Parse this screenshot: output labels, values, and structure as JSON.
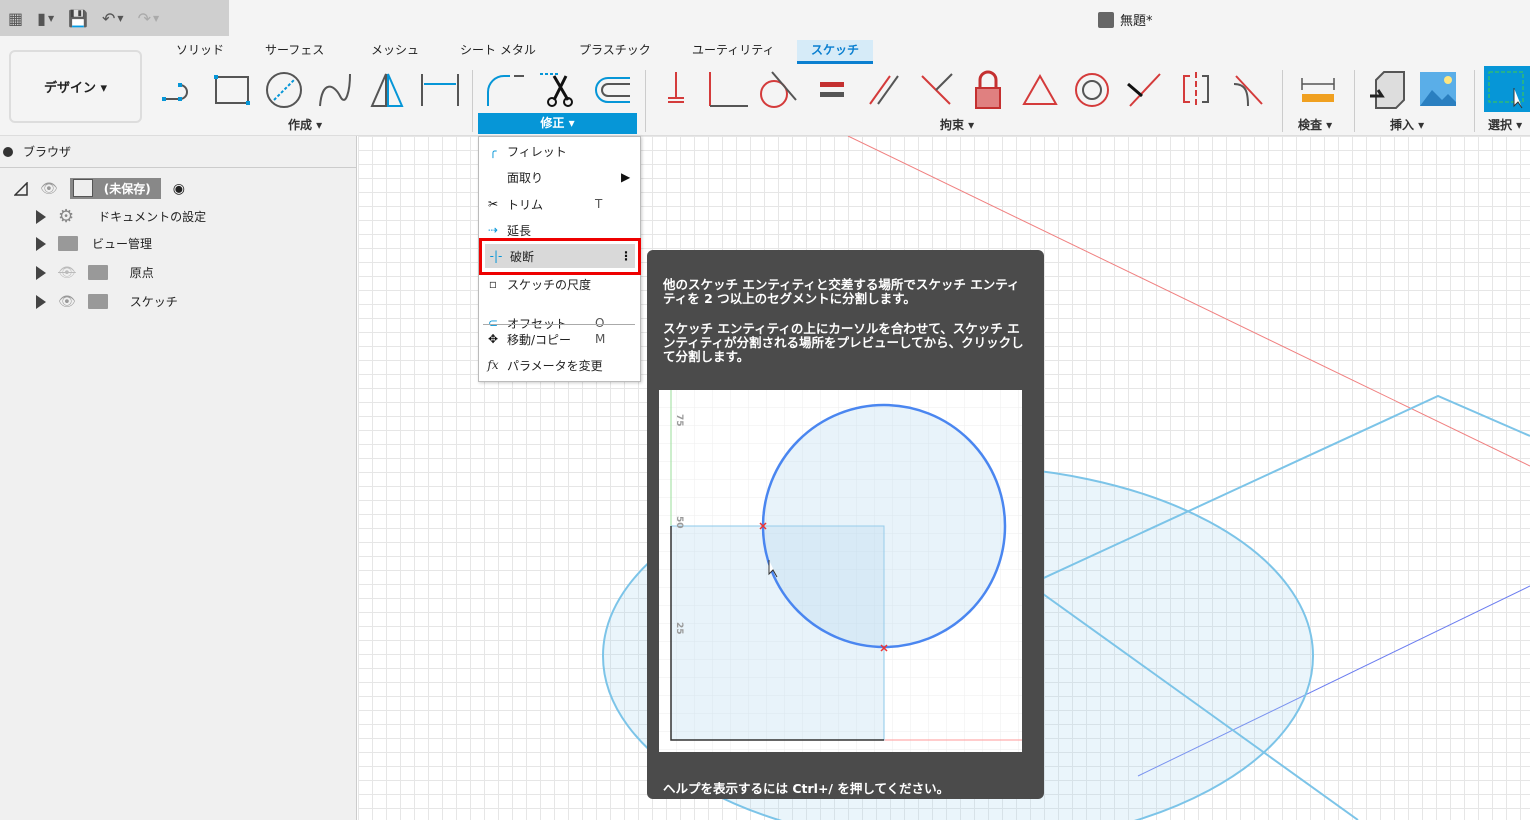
{
  "quick_access": {
    "apps": "▦",
    "file": "▮",
    "save": "💾",
    "undo": "↶",
    "redo": "↷"
  },
  "title": "無題*",
  "workspace": "デザイン ▾",
  "tabs": [
    {
      "label": "ソリッド"
    },
    {
      "label": "サーフェス"
    },
    {
      "label": "メッシュ"
    },
    {
      "label": "シート メタル"
    },
    {
      "label": "プラスチック"
    },
    {
      "label": "ユーティリティ"
    },
    {
      "label": "スケッチ",
      "active": true
    }
  ],
  "groups": {
    "create": "作成 ▾",
    "modify": "修正 ▾",
    "constraints": "拘束 ▾",
    "inspect": "検査 ▾",
    "insert": "挿入 ▾",
    "select": "選択 ▾"
  },
  "browser": {
    "title": "ブラウザ",
    "root": "(未保存)",
    "items": [
      {
        "label": "ドキュメントの設定"
      },
      {
        "label": "ビュー管理"
      },
      {
        "label": "原点"
      },
      {
        "label": "スケッチ"
      }
    ]
  },
  "menu": {
    "items": [
      {
        "label": "フィレット",
        "shortcut": ""
      },
      {
        "label": "面取り",
        "shortcut": "▶"
      },
      {
        "label": "トリム",
        "shortcut": "T"
      },
      {
        "label": "延長",
        "shortcut": ""
      },
      {
        "label": "破断",
        "shortcut": "⋮"
      },
      {
        "label": "スケッチの尺度",
        "shortcut": ""
      },
      {
        "label": "オフセット",
        "shortcut": "O"
      },
      {
        "label": "移動/コピー",
        "shortcut": "M"
      },
      {
        "label": "パラメータを変更",
        "shortcut": ""
      }
    ]
  },
  "tooltip": {
    "p1": "他のスケッチ エンティティと交差する場所でスケッチ エンティティを 2 つ以上のセグメントに分割します。",
    "p2": "スケッチ エンティティの上にカーソルを合わせて、スケッチ エンティティが分割される場所をプレビューしてから、クリックして分割します。",
    "footer": "ヘルプを表示するには Ctrl+/ を押してください。",
    "axis": [
      "75",
      "50",
      "25"
    ]
  },
  "colors": {
    "accent": "#0696d7",
    "constraint": "#d43b3b",
    "highlight": "#ee0000"
  }
}
